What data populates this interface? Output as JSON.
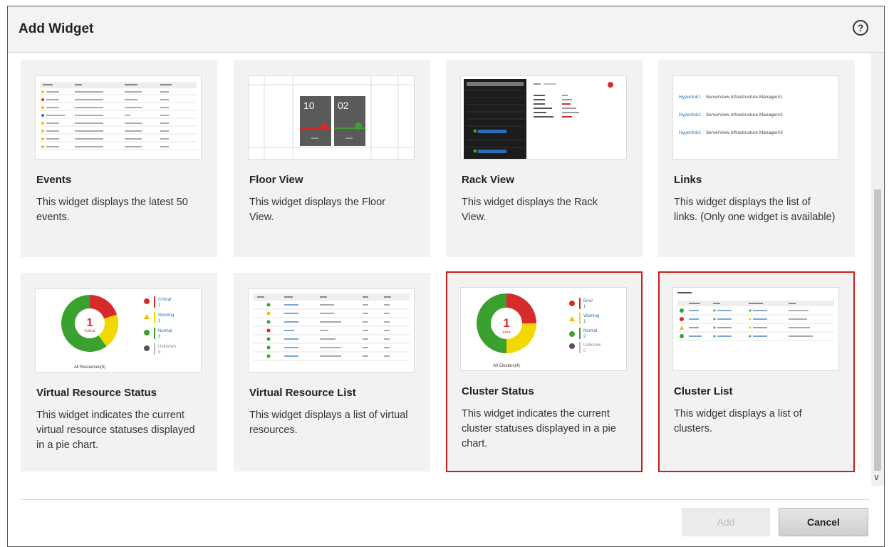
{
  "dialog": {
    "title": "Add Widget",
    "help_glyph": "?"
  },
  "widgets": [
    {
      "id": "events",
      "title": "Events",
      "description": "This widget displays the latest 50 events.",
      "selected": false
    },
    {
      "id": "floor-view",
      "title": "Floor View",
      "description": "This widget displays the Floor View.",
      "selected": false
    },
    {
      "id": "rack-view",
      "title": "Rack View",
      "description": "This widget displays the Rack View.",
      "selected": false
    },
    {
      "id": "links",
      "title": "Links",
      "description": "This widget displays the list of links. (Only one widget is available)",
      "selected": false
    },
    {
      "id": "virtual-resource-status",
      "title": "Virtual Resource Status",
      "description": "This widget indicates the current virtual resource statuses displayed in a pie chart.",
      "selected": false
    },
    {
      "id": "virtual-resource-list",
      "title": "Virtual Resource List",
      "description": "This widget displays a list of virtual resources.",
      "selected": false
    },
    {
      "id": "cluster-status",
      "title": "Cluster Status",
      "description": "This widget indicates the current cluster statuses displayed in a pie chart.",
      "selected": true
    },
    {
      "id": "cluster-list",
      "title": "Cluster List",
      "description": "This widget displays a list of clusters.",
      "selected": true
    }
  ],
  "previews": {
    "floor_view": {
      "tile_a": "10",
      "tile_b": "02"
    },
    "links": {
      "items": [
        {
          "link": "Hyperlink1",
          "text": "ServerView Infrastructure Manager#1"
        },
        {
          "link": "Hyperlink2",
          "text": "ServerView Infrastructure Manager#2"
        },
        {
          "link": "Hyperlink3",
          "text": "ServerView Infrastructure Manager#3"
        }
      ]
    },
    "vr_status": {
      "center_count": "1",
      "center_label": "Critical",
      "footer": "All Resources(5)",
      "legend": [
        {
          "label": "Critical",
          "count": "1",
          "color": "#d62b2b",
          "icon": "error-icon"
        },
        {
          "label": "Warning",
          "count": "1",
          "color": "#f0d800",
          "icon": "warning-icon"
        },
        {
          "label": "Normal",
          "count": "3",
          "color": "#3aa12e",
          "icon": "check-icon"
        },
        {
          "label": "Unknown",
          "count": "0",
          "color": "#bbbbbb",
          "icon": "question-icon"
        }
      ]
    },
    "cluster_status": {
      "center_count": "1",
      "center_label": "Error",
      "footer": "All Clusters(4)",
      "legend": [
        {
          "label": "Error",
          "count": "1",
          "color": "#d62b2b",
          "icon": "error-icon"
        },
        {
          "label": "Warning",
          "count": "1",
          "color": "#f0d800",
          "icon": "warning-icon"
        },
        {
          "label": "Normal",
          "count": "2",
          "color": "#3aa12e",
          "icon": "check-icon"
        },
        {
          "label": "Unknown",
          "count": "0",
          "color": "#bbbbbb",
          "icon": "question-icon"
        }
      ]
    }
  },
  "footer": {
    "add_label": "Add",
    "cancel_label": "Cancel"
  },
  "colors": {
    "selected_border": "#cc1b1b",
    "card_bg": "#f2f2f2",
    "link": "#2a6ebb"
  }
}
